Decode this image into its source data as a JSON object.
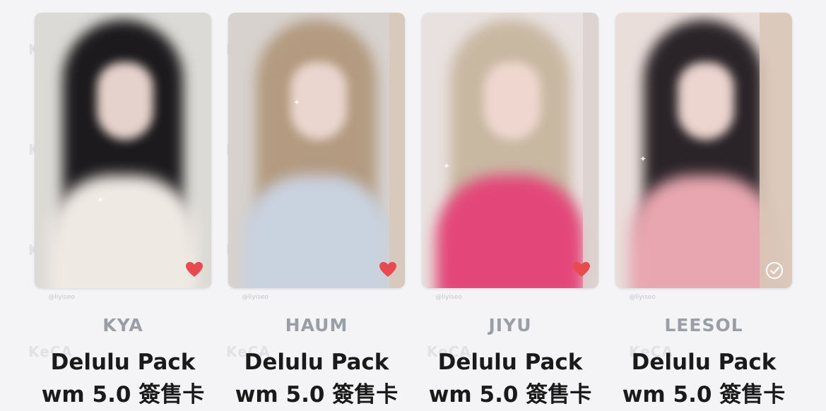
{
  "watermark": {
    "text": "KeCA",
    "credit": "@liyiseo"
  },
  "cards": [
    {
      "member": "KYA",
      "title_line1": "Delulu Pack",
      "title_line2": "wm 5.0 簽售卡",
      "status": "heart",
      "status_icon": "heart-icon",
      "colors": {
        "bg": "#dcdad6",
        "hair": "#1c1a1c",
        "face": "#e6d2cc",
        "body": "#efe9e3",
        "strip": "#cfcac3"
      }
    },
    {
      "member": "HAUM",
      "title_line1": "Delulu Pack",
      "title_line2": "wm 5.0 簽售卡",
      "status": "heart",
      "status_icon": "heart-icon",
      "colors": {
        "bg": "#d7d2cd",
        "hair": "#b39a80",
        "face": "#ead6cf",
        "body": "#c9d2df",
        "strip": "#d8c8bb"
      }
    },
    {
      "member": "JIYU",
      "title_line1": "Delulu Pack",
      "title_line2": "wm 5.0 簽售卡",
      "status": "heart",
      "status_icon": "heart-icon",
      "colors": {
        "bg": "#e9e1df",
        "hair": "#c8b8a2",
        "face": "#efd7d0",
        "body": "#e3477a",
        "strip": "#dcd2cf"
      }
    },
    {
      "member": "LEESOL",
      "title_line1": "Delulu Pack",
      "title_line2": "wm 5.0 簽售卡",
      "status": "check",
      "status_icon": "check-circle-icon",
      "colors": {
        "bg": "#eadedb",
        "hair": "#2a2428",
        "face": "#ecd4cf",
        "body": "#e7a6b0",
        "strip": "#d9c6b8"
      }
    }
  ],
  "accent": {
    "heart": "#e84b4f",
    "check": "#ffffff"
  }
}
